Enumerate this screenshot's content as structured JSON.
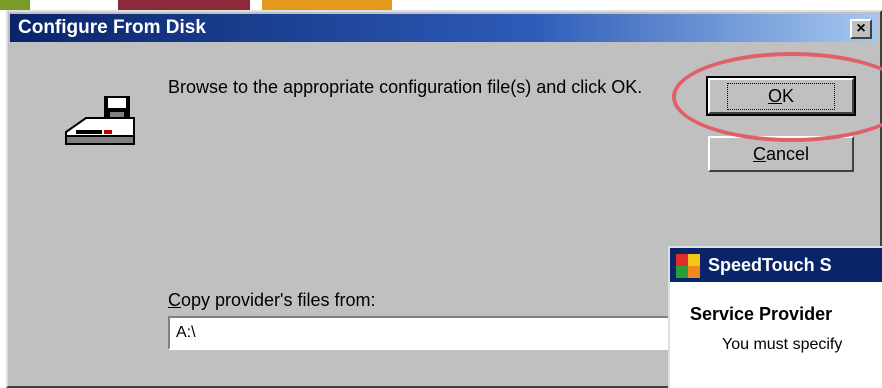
{
  "dialog": {
    "title": "Configure From Disk",
    "close_symbol": "×",
    "message": "Browse to the appropriate configuration file(s) and click OK.",
    "ok_label": "OK",
    "cancel_label": "Cancel",
    "copy_label": "Copy provider's files from:",
    "copy_value": "A:\\",
    "icon": "floppy-disk-drive-icon"
  },
  "overlay_window": {
    "title": "SpeedTouch S",
    "heading": "Service Provider",
    "text": "You must specify"
  },
  "colors": {
    "highlight": "#e0606a",
    "titlebar": "#0a246a"
  }
}
